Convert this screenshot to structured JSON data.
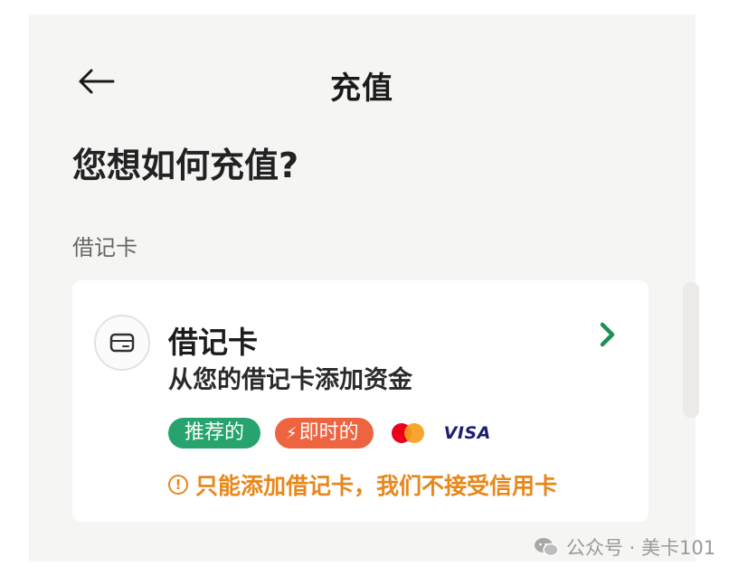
{
  "header": {
    "title": "充值",
    "back_icon": "arrow-left-icon"
  },
  "page": {
    "heading": "您想如何充值?",
    "section_label": "借记卡"
  },
  "debit_card_option": {
    "icon": "card-icon",
    "title": "借记卡",
    "subtitle": "从您的借记卡添加资金",
    "tags": {
      "recommended": "推荐的",
      "instant": "即时的",
      "instant_icon": "lightning-icon"
    },
    "payment_logos": {
      "mastercard": "mastercard-logo",
      "visa": "VISA"
    },
    "warning": "只能添加借记卡，我们不接受信用卡",
    "warning_icon": "info-icon",
    "chevron_icon": "chevron-right-icon"
  },
  "watermark": {
    "text": "公众号 · 美卡101",
    "icon": "wechat-icon"
  },
  "colors": {
    "accent_green": "#27a36d",
    "accent_orange": "#ee6340",
    "warning": "#e8871b",
    "chevron": "#1f8f5a"
  }
}
